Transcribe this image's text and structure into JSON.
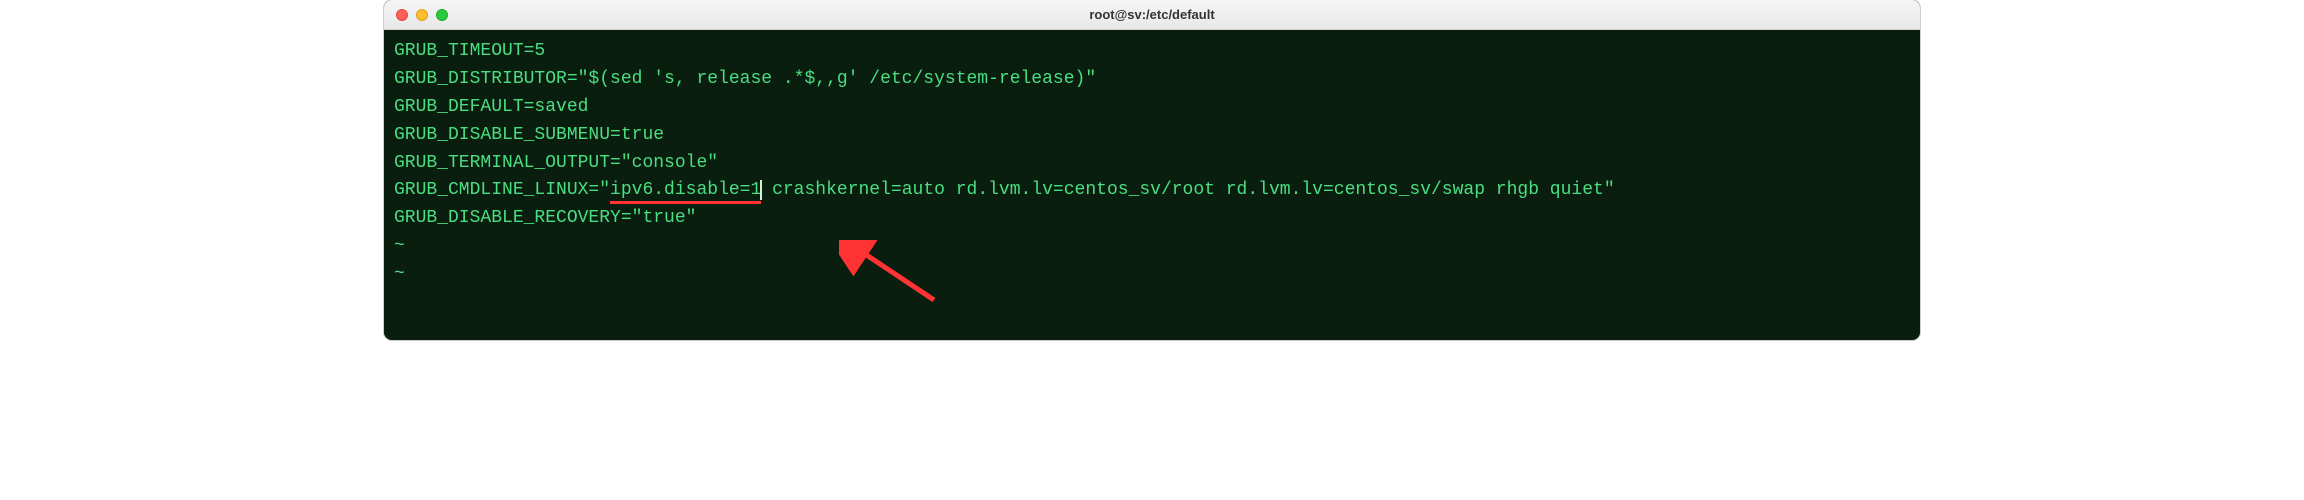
{
  "window": {
    "title": "root@sv:/etc/default"
  },
  "terminal": {
    "lines": [
      "GRUB_TIMEOUT=5",
      "GRUB_DISTRIBUTOR=\"$(sed 's, release .*$,,g' /etc/system-release)\"",
      "GRUB_DEFAULT=saved",
      "GRUB_DISABLE_SUBMENU=true",
      "GRUB_TERMINAL_OUTPUT=\"console\""
    ],
    "line6_prefix": "GRUB_CMDLINE_LINUX=\"",
    "line6_highlight": "ipv6.disable=1",
    "line6_suffix": " crashkernel=auto rd.lvm.lv=centos_sv/root rd.lvm.lv=centos_sv/swap rhgb quiet\"",
    "line7": "GRUB_DISABLE_RECOVERY=\"true\"",
    "tilde": "~"
  }
}
